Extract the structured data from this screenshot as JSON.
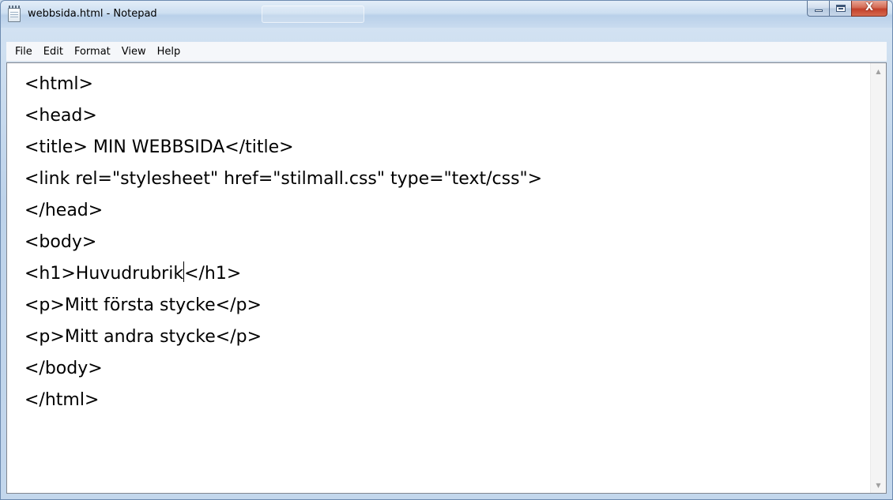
{
  "window": {
    "title": "webbsida.html - Notepad",
    "close_symbol": "X"
  },
  "menu": {
    "items": [
      "File",
      "Edit",
      "Format",
      "View",
      "Help"
    ]
  },
  "editor": {
    "lines": [
      "<html>",
      "<head>",
      "<title> MIN WEBBSIDA</title>",
      "<link rel=\"stylesheet\" href=\"stilmall.css\" type=\"text/css\">",
      "</head>",
      "<body>",
      "<h1>Huvudrubrik</h1>",
      "<p>Mitt första stycke</p>",
      "<p>Mitt andra stycke</p>",
      "</body>",
      "</html>"
    ],
    "caret": {
      "line_index": 6,
      "char_index": 15
    }
  },
  "icons": {
    "app": "notepad-icon",
    "minimize": "minimize-icon",
    "maximize": "maximize-icon",
    "close": "close-icon",
    "scroll_up": "scroll-up-arrow-icon",
    "scroll_down": "scroll-down-arrow-icon"
  },
  "colors": {
    "close_button": "#c3402a",
    "editor_background": "#ffffff",
    "titlebar": "#cddff1"
  }
}
